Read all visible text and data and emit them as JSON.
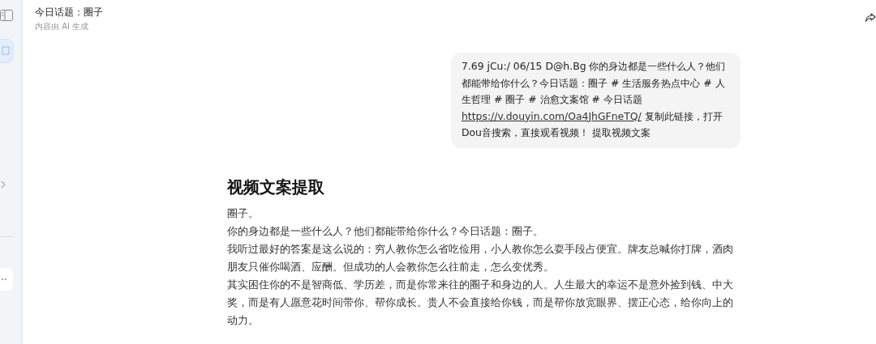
{
  "header": {
    "title": "今日话题：圈子",
    "subtitle": "内容由 AI 生成"
  },
  "message": {
    "text_before": "7.69 jCu:/ 06/15 D@h.Bg 你的身边都是一些什么人？他们都能带给你什么？今日话题：圈子 # 生活服务热点中心 # 人生哲理 # 圈子 # 治愈文案馆 # 今日话题 ",
    "link": "https://v.douyin.com/Oa4JhGFneTQ/",
    "text_after": " 复制此链接，打开Dou音搜索，直接观看视频！ 提取视频文案"
  },
  "answer": {
    "heading": "视频文案提取",
    "paragraphs": [
      "圈子。",
      "你的身边都是一些什么人？他们都能带给你什么？今日话题：圈子。",
      "我听过最好的答案是这么说的：穷人教你怎么省吃俭用，小人教你怎么耍手段占便宜。牌友总喊你打牌，酒肉朋友只催你喝酒、应酬。但成功的人会教你怎么往前走，怎么变优秀。",
      "其实困住你的不是智商低、学历差，而是你常来往的圈子和身边的人。人生最大的幸运不是意外捡到钱、中大奖，而是有人愿意花时间带你、帮你成长。贵人不会直接给你钱，而是帮你放宽眼界、摆正心态，给你向上的动力。"
    ]
  }
}
